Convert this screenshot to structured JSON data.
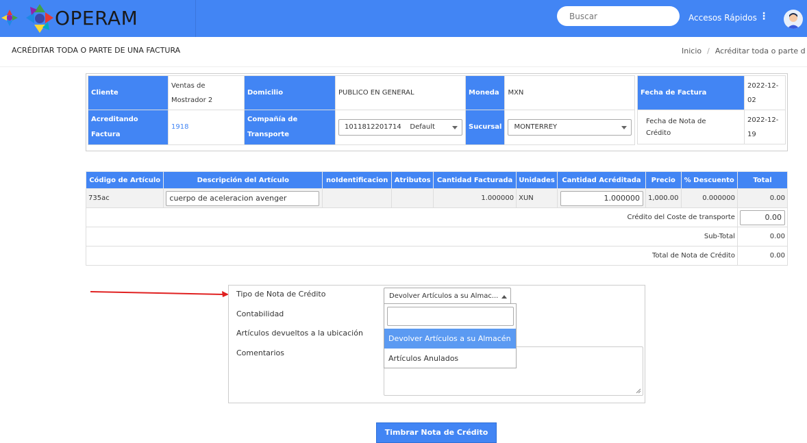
{
  "app": {
    "brand": "OPERAM"
  },
  "header": {
    "search_placeholder": "Buscar",
    "quick_access": "Accesos Rápidos"
  },
  "page": {
    "title": "ACRÉDITAR TODA O PARTE DE UNA FACTURA",
    "breadcrumb": [
      "Inicio",
      "Acréditar toda o parte d"
    ]
  },
  "invoice": {
    "cliente_label": "Cliente",
    "cliente_value_line1": "Ventas de",
    "cliente_value_line2": "Mostrador 2",
    "domicilio_label": "Domicilio",
    "domicilio_value": "PUBLICO EN GENERAL",
    "moneda_label": "Moneda",
    "moneda_value": "MXN",
    "acreditando_label_line1": "Acreditando",
    "acreditando_label_line2": "Factura",
    "acreditando_value": "1918",
    "transporte_label_line1": "Compañía de",
    "transporte_label_line2": "Transporte",
    "transporte_value": "1011812201714    Default",
    "sucursal_label": "Sucursal",
    "sucursal_value": "MONTERREY",
    "fecha_factura_label": "Fecha de Factura",
    "fecha_factura_line1": "2022-12-",
    "fecha_factura_line2": "02",
    "fecha_nota_label_line1": "Fecha de Nota de",
    "fecha_nota_label_line2": "Crédito",
    "fecha_nota_line1": "2022-12-",
    "fecha_nota_line2": "19"
  },
  "items": {
    "columns": [
      "Código de Artículo",
      "Descripción del Artículo",
      "noIdentificacion",
      "Atributos",
      "Cantidad Facturada",
      "Unidades",
      "Cantidad Acréditada",
      "Precio",
      "% Descuento",
      "Total"
    ],
    "rows": [
      {
        "codigo": "735ac",
        "descripcion": "cuerpo de aceleracion avenger",
        "noident": "",
        "atributos": "",
        "cant_facturada": "1.000000",
        "unidades": "XUN",
        "cant_acreditada": "1.000000",
        "precio": "1,000.00",
        "descuento": "0.000000",
        "total": "0.00"
      }
    ],
    "credito_transporte_label": "Crédito del Coste de transporte",
    "credito_transporte_value": "0.00",
    "subtotal_label": "Sub-Total",
    "subtotal_value": "0.00",
    "total_label": "Total de Nota de Crédito",
    "total_value": "0.00"
  },
  "form": {
    "tipo_label": "Tipo de Nota de Crédito",
    "tipo_value": "Devolver Artículos a su Almac...",
    "contabilidad_label": "Contabilidad",
    "articulos_label": "Artículos devueltos a la ubicación",
    "comentarios_label": "Comentarios",
    "options": [
      "Devolver Artículos a su Almacén",
      "Artículos Anulados"
    ]
  },
  "submit_label": "Timbrar Nota de Crédito",
  "colors": {
    "accent": "#4285f4",
    "arrow": "#e02020"
  }
}
